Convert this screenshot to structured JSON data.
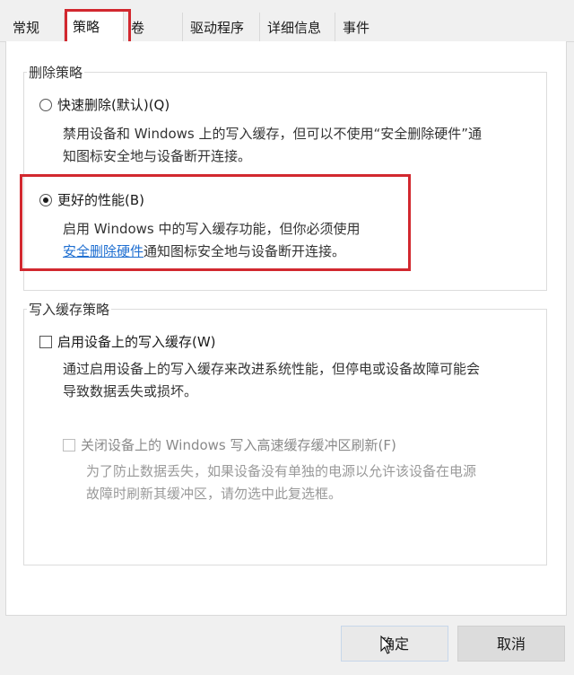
{
  "tabs": [
    {
      "label": "常规"
    },
    {
      "label": "策略"
    },
    {
      "label": "卷"
    },
    {
      "label": "驱动程序"
    },
    {
      "label": "详细信息"
    },
    {
      "label": "事件"
    }
  ],
  "removal_policy": {
    "title": "删除策略",
    "quick_removal": {
      "label": "快速删除(默认)(Q)",
      "desc_line1": "禁用设备和 Windows 上的写入缓存，但可以不使用“安全删除硬件”通",
      "desc_line2": "知图标安全地与设备断开连接。"
    },
    "better_performance": {
      "label": "更好的性能(B)",
      "desc_line1": "启用 Windows 中的写入缓存功能，但你必须使用",
      "desc_link": "安全删除硬件",
      "desc_line2_rest": "通知图标安全地与设备断开连接。"
    }
  },
  "write_cache_policy": {
    "title": "写入缓存策略",
    "enable_cache": {
      "label": "启用设备上的写入缓存(W)",
      "desc_line1": "通过启用设备上的写入缓存来改进系统性能，但停电或设备故障可能会",
      "desc_line2": "导致数据丢失或损坏。"
    },
    "turn_off_flush": {
      "label": "关闭设备上的 Windows 写入高速缓存缓冲区刷新(F)",
      "desc_line1": "为了防止数据丢失，如果设备没有单独的电源以允许该设备在电源",
      "desc_line2": "故障时刷新其缓冲区，请勿选中此复选框。"
    }
  },
  "buttons": {
    "ok": "确定",
    "cancel": "取消"
  },
  "colors": {
    "highlight_red": "#d2282f",
    "link_blue": "#1f6fd1"
  }
}
